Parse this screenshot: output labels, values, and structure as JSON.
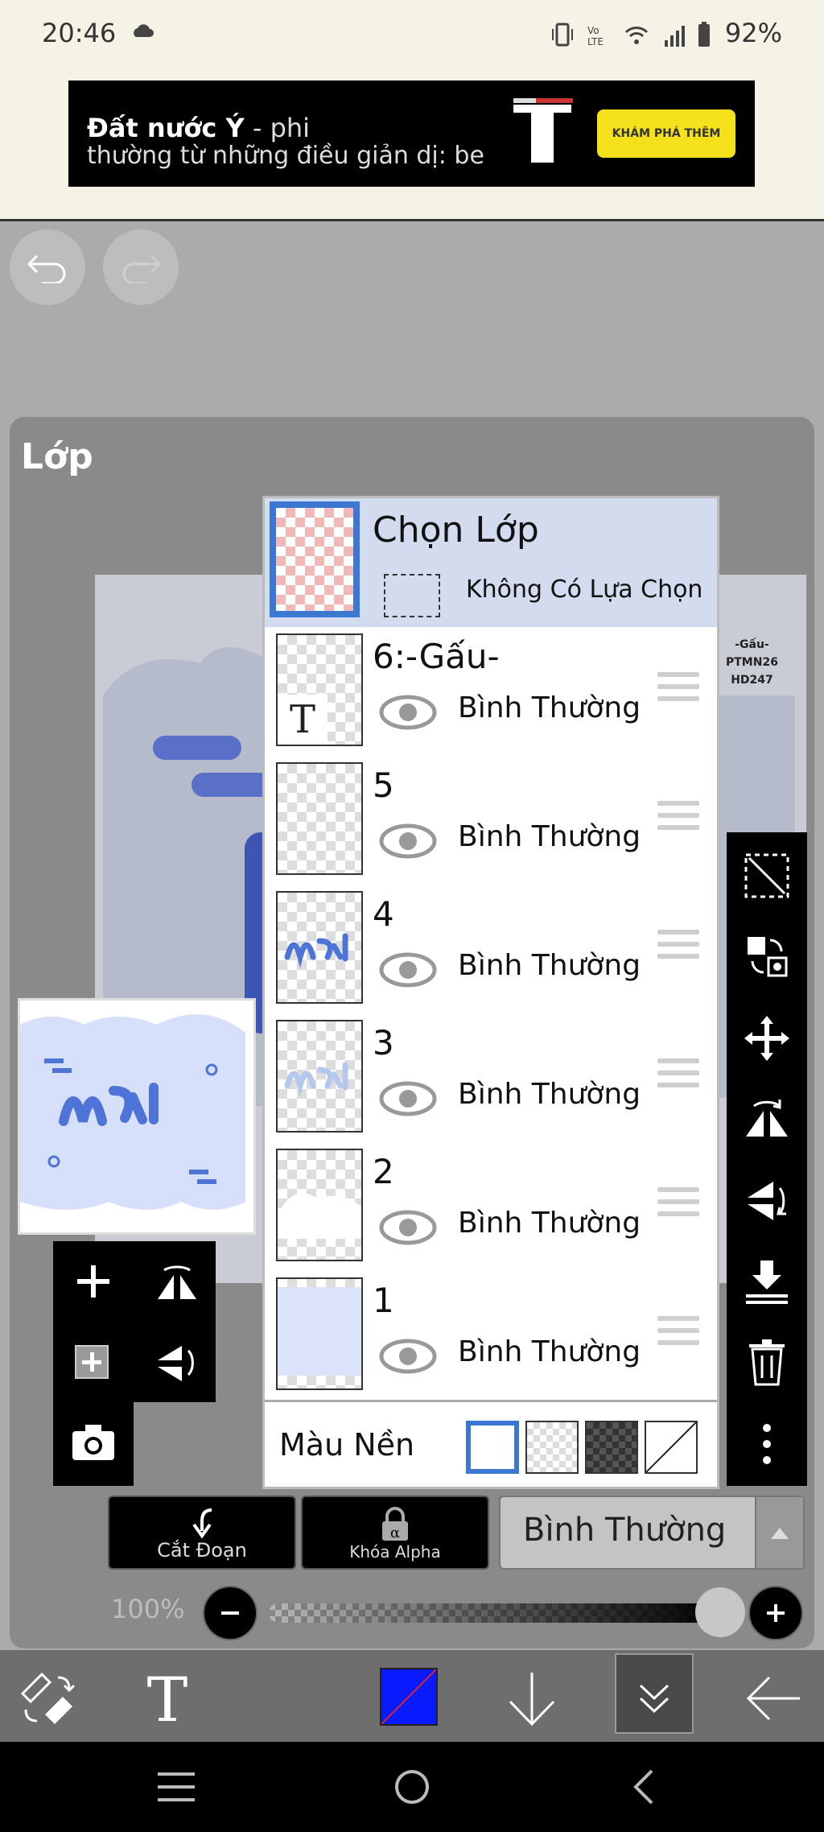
{
  "status": {
    "time": "20:46",
    "battery": "92%"
  },
  "ad": {
    "headline_bold": "Đất nước Ý",
    "headline_rest": " - phi",
    "line2": "thường từ những điều giản dị: be",
    "cta": "KHÁM PHÁ THÊM"
  },
  "panel": {
    "title": "Lớp"
  },
  "layers": {
    "select_row": {
      "name": "Chọn Lớp",
      "selection": "Không Có Lựa Chọn"
    },
    "items": [
      {
        "name": "6:-Gấu-",
        "mode": "Bình Thường"
      },
      {
        "name": "5",
        "mode": "Bình Thường"
      },
      {
        "name": "4",
        "mode": "Bình Thường"
      },
      {
        "name": "3",
        "mode": "Bình Thường"
      },
      {
        "name": "2",
        "mode": "Bình Thường"
      },
      {
        "name": "1",
        "mode": "Bình Thường"
      }
    ],
    "background_label": "Màu Nền"
  },
  "canvas": {
    "watermark": "-Gấu-\nPTMN26\nHD247"
  },
  "controls": {
    "clip_label": "Cắt Đoạn",
    "alpha_lock_label": "Khóa Alpha",
    "blend_mode": "Bình Thường",
    "opacity": "100%"
  },
  "colors": {
    "accent": "#3a78d4",
    "current_color": "#0a1bff"
  }
}
